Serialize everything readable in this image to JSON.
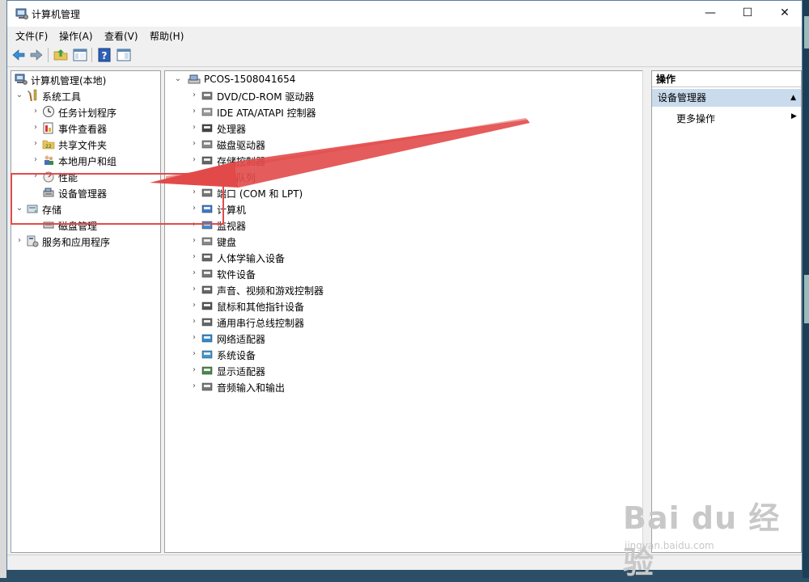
{
  "window": {
    "title": "计算机管理",
    "controls": {
      "minimize": "—",
      "maximize": "☐",
      "close": "✕"
    }
  },
  "menu": [
    {
      "label": "文件(F)"
    },
    {
      "label": "操作(A)"
    },
    {
      "label": "查看(V)"
    },
    {
      "label": "帮助(H)"
    }
  ],
  "toolbar": {
    "buttons": [
      {
        "name": "back",
        "icon": "arrow-left-icon"
      },
      {
        "name": "forward",
        "icon": "arrow-right-icon"
      },
      {
        "name": "up",
        "icon": "up-folder-icon"
      },
      {
        "name": "show-hide-tree",
        "icon": "console-tree-icon"
      },
      {
        "name": "help",
        "icon": "help-icon"
      },
      {
        "name": "show-hide-action",
        "icon": "action-pane-icon"
      }
    ]
  },
  "tree": {
    "root": {
      "label": "计算机管理(本地)"
    },
    "system_tools": {
      "label": "系统工具"
    },
    "task_scheduler": {
      "label": "任务计划程序"
    },
    "event_viewer": {
      "label": "事件查看器"
    },
    "shared_folders": {
      "label": "共享文件夹"
    },
    "local_users": {
      "label": "本地用户和组"
    },
    "performance": {
      "label": "性能"
    },
    "device_manager": {
      "label": "设备管理器"
    },
    "storage": {
      "label": "存储"
    },
    "disk_management": {
      "label": "磁盘管理"
    },
    "services_apps": {
      "label": "服务和应用程序"
    }
  },
  "devices": {
    "computer_name": "PCOS-1508041654",
    "categories": [
      "DVD/CD-ROM 驱动器",
      "IDE ATA/ATAPI 控制器",
      "处理器",
      "磁盘驱动器",
      "存储控制器",
      "打印队列",
      "端口 (COM 和 LPT)",
      "计算机",
      "监视器",
      "键盘",
      "人体学输入设备",
      "软件设备",
      "声音、视频和游戏控制器",
      "鼠标和其他指针设备",
      "通用串行总线控制器",
      "网络适配器",
      "系统设备",
      "显示适配器",
      "音频输入和输出"
    ]
  },
  "actions": {
    "header": "操作",
    "section": "设备管理器",
    "more": "更多操作"
  },
  "watermark": {
    "logo": "Bai du 经验",
    "url": "jingyan.baidu.com"
  },
  "colors": {
    "annotation": "#e24a4a",
    "action_section_bg": "#c9dbec",
    "window_border": "#5a7fa0"
  }
}
